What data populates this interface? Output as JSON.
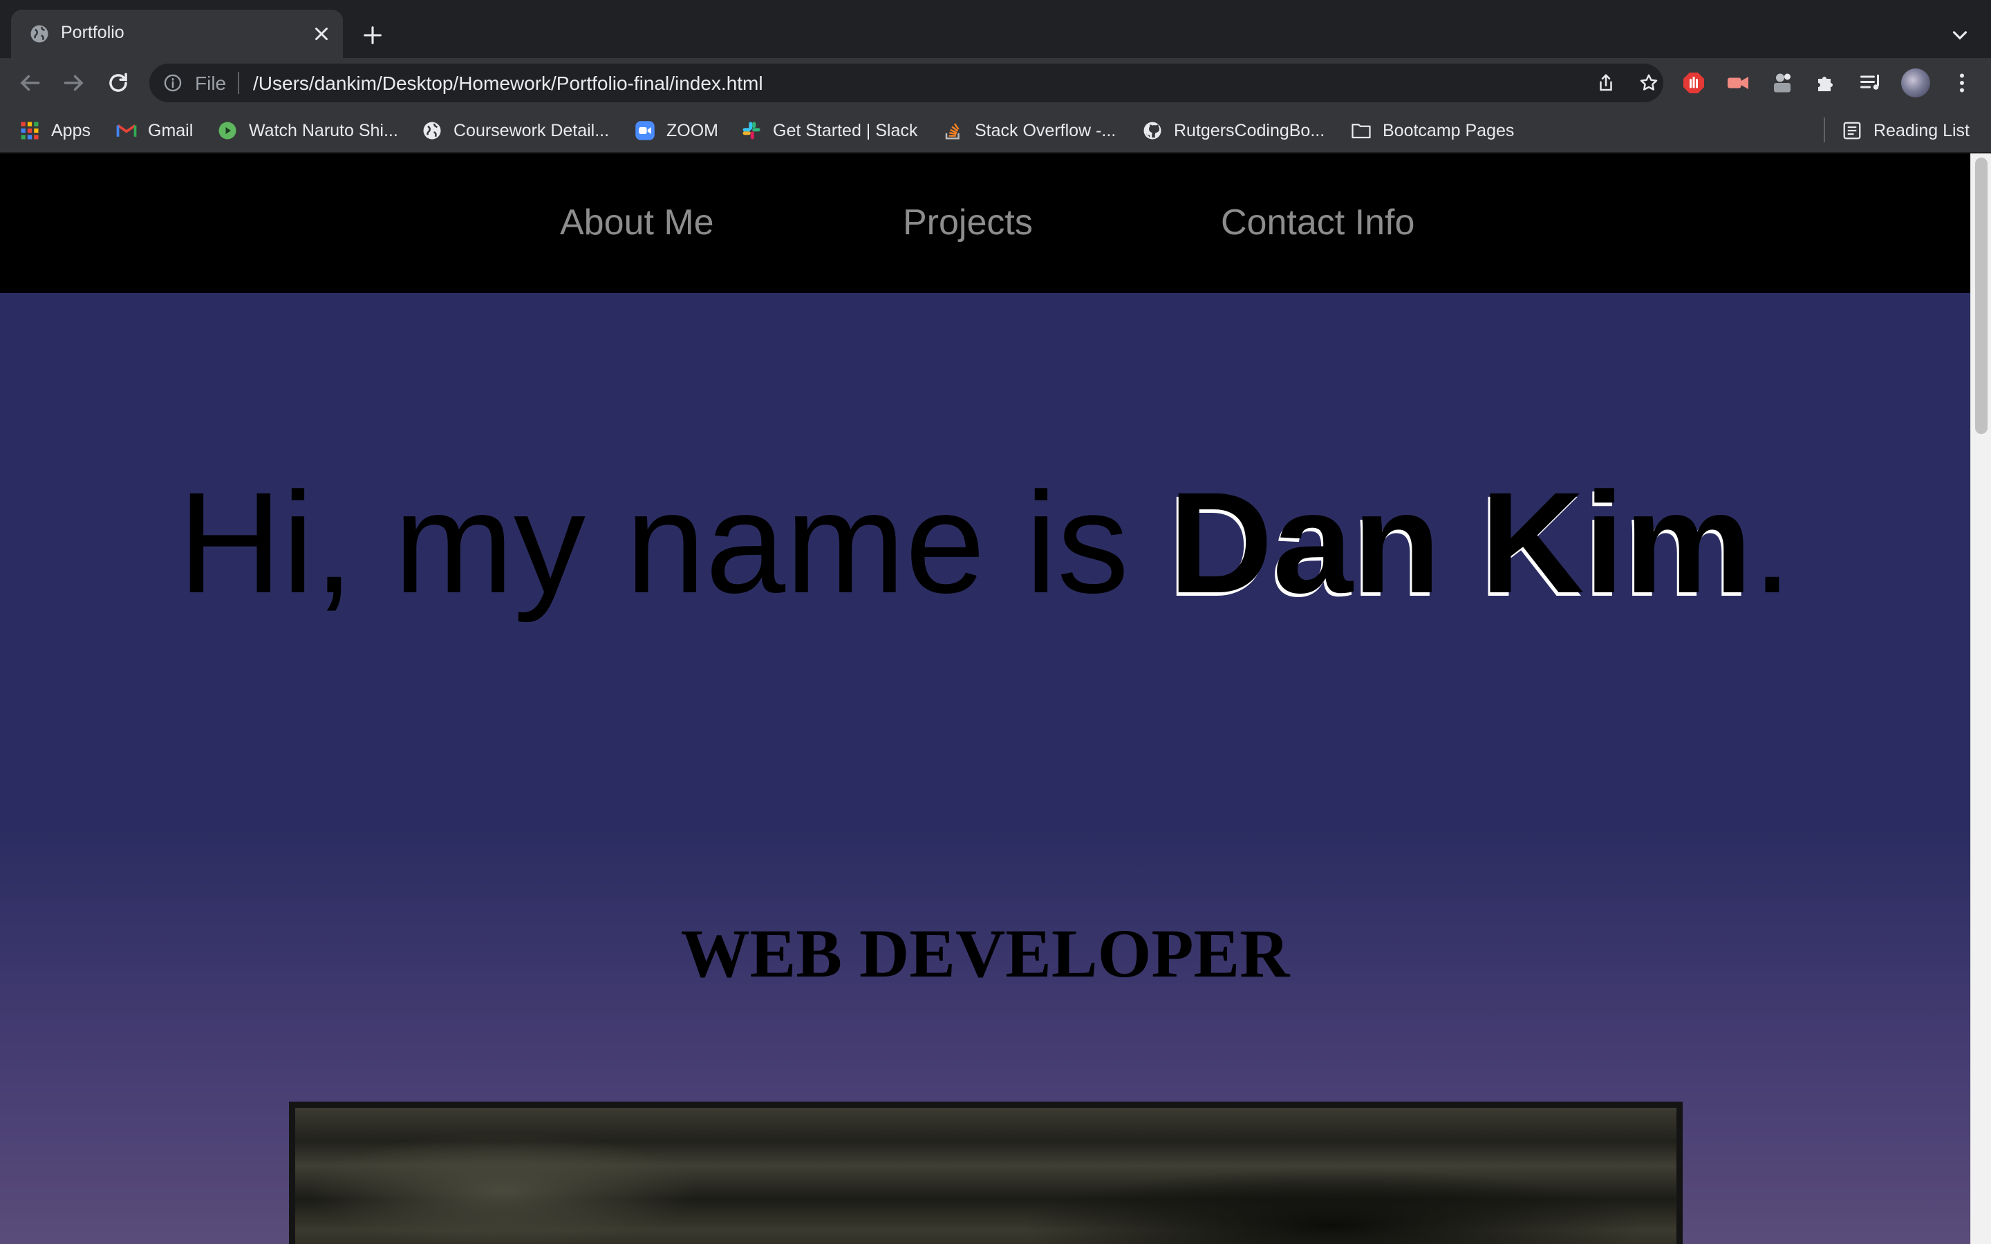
{
  "browser": {
    "tab": {
      "title": "Portfolio"
    },
    "omnibox": {
      "scheme_label": "File",
      "url": "/Users/dankim/Desktop/Homework/Portfolio-final/index.html"
    },
    "bookmarks": [
      {
        "label": "Apps",
        "icon": "apps-grid-icon"
      },
      {
        "label": "Gmail",
        "icon": "gmail-icon"
      },
      {
        "label": "Watch Naruto Shi...",
        "icon": "play-circle-icon"
      },
      {
        "label": "Coursework Detail...",
        "icon": "globe-icon"
      },
      {
        "label": "ZOOM",
        "icon": "zoom-icon"
      },
      {
        "label": "Get Started | Slack",
        "icon": "slack-icon"
      },
      {
        "label": "Stack Overflow -...",
        "icon": "stack-overflow-icon"
      },
      {
        "label": "RutgersCodingBo...",
        "icon": "github-icon"
      },
      {
        "label": "Bootcamp Pages",
        "icon": "folder-icon"
      }
    ],
    "reading_list_label": "Reading List"
  },
  "page": {
    "nav": [
      {
        "label": "About Me"
      },
      {
        "label": "Projects"
      },
      {
        "label": "Contact Info"
      }
    ],
    "hero": {
      "greeting": "Hi, my name is ",
      "name": "Dan Kim",
      "punctuation": "."
    },
    "subtitle": "WEB DEVELOPER"
  },
  "colors": {
    "nav_background": "#000000",
    "nav_link": "#8d8d8d",
    "page_background_top": "#2b2d62",
    "page_background_bottom": "#5a4c7a",
    "name_text_shadow": "#ffffff"
  }
}
